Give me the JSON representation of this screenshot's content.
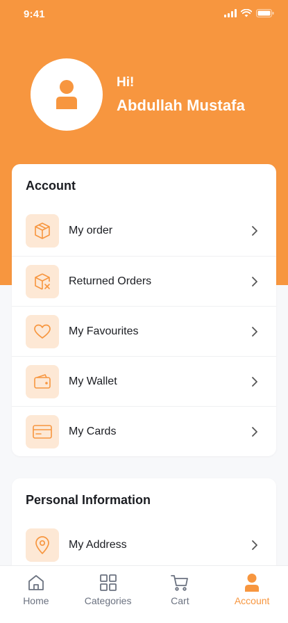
{
  "status_bar": {
    "time": "9:41"
  },
  "profile": {
    "greeting": "Hi!",
    "name": "Abdullah Mustafa"
  },
  "account_section": {
    "title": "Account",
    "items": [
      {
        "label": "My order",
        "icon": "package-icon"
      },
      {
        "label": "Returned Orders",
        "icon": "package-return-icon"
      },
      {
        "label": "My Favourites",
        "icon": "heart-icon"
      },
      {
        "label": "My Wallet",
        "icon": "wallet-icon"
      },
      {
        "label": "My Cards",
        "icon": "credit-card-icon"
      }
    ]
  },
  "personal_section": {
    "title": "Personal Information",
    "items": [
      {
        "label": "My Address",
        "icon": "location-pin-icon"
      }
    ]
  },
  "bottom_nav": {
    "items": [
      {
        "label": "Home",
        "icon": "home-icon",
        "active": false
      },
      {
        "label": "Categories",
        "icon": "grid-icon",
        "active": false
      },
      {
        "label": "Cart",
        "icon": "cart-icon",
        "active": false
      },
      {
        "label": "Account",
        "icon": "user-icon",
        "active": true
      }
    ]
  },
  "colors": {
    "accent": "#F7963F",
    "icon_bg": "#FDE8D5",
    "text": "#1B1D22",
    "muted": "#6B7280"
  }
}
